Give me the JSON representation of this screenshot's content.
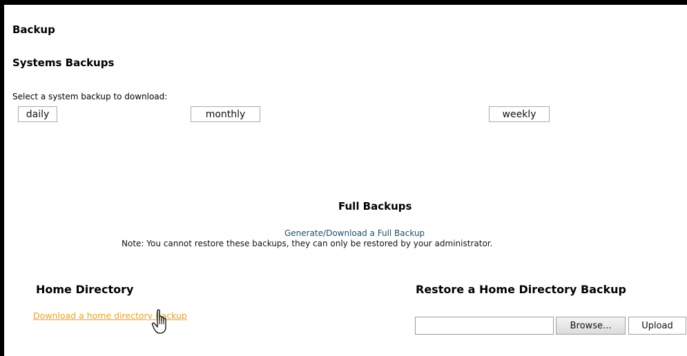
{
  "page": {
    "title": "Backup"
  },
  "systems": {
    "heading": "Systems Backups",
    "select_label": "Select a system backup to download:",
    "buttons": {
      "daily": "daily",
      "monthly": "monthly",
      "weekly": "weekly"
    }
  },
  "full": {
    "heading": "Full Backups",
    "link": "Generate/Download a Full Backup",
    "note": "Note: You cannot restore these backups, they can only be restored by your administrator."
  },
  "home": {
    "heading": "Home Directory",
    "link": "Download a home directory Backup"
  },
  "restore": {
    "heading": "Restore a Home Directory Backup",
    "file_value": "",
    "browse_label": "Browse...",
    "upload_label": "Upload"
  },
  "colors": {
    "link_blue": "#1c4f6e",
    "link_orange": "#f0a020"
  },
  "icons": {
    "cursor": "hand-pointer-icon"
  }
}
